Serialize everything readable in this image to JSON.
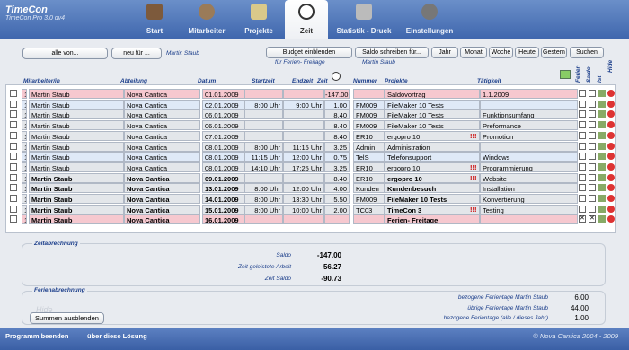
{
  "app": {
    "title": "TimeCon",
    "subtitle": "TimeCon Pro 3.0 dv4"
  },
  "nav": [
    {
      "label": "Start"
    },
    {
      "label": "Mitarbeiter"
    },
    {
      "label": "Projekte"
    },
    {
      "label": "Zeit"
    },
    {
      "label": "Statistik - Druck"
    },
    {
      "label": "Einstellungen"
    }
  ],
  "toolbar": {
    "alle_von": "alle von...",
    "neu_fur": "neu für ...",
    "filter_person": "Martin Staub",
    "budget_btn": "Budget einblenden",
    "budget_note": "für Ferien- Freitage",
    "saldo_btn": "Saldo schreiben für...",
    "saldo_person": "Martin Staub",
    "periods": [
      "Jahr",
      "Monat",
      "Woche",
      "Heute",
      "Gestern"
    ],
    "suchen": "Suchen"
  },
  "columns": {
    "mitarbeiter": "Mitarbeiter/in",
    "abteilung": "Abteilung",
    "datum": "Datum",
    "startzeit": "Startzeit",
    "endzeit": "Endzeit",
    "zeit": "Zeit",
    "nummer": "Nummer",
    "projekte": "Projekte",
    "taetigkeit": "Tätigkeit",
    "ferien": "Ferien",
    "saldo": "Saldo",
    "ist": "Ist",
    "hide": "Hide"
  },
  "rows": [
    {
      "n": "1",
      "ma": "Martin Staub",
      "abt": "Nova Cantica",
      "dat": "01.01.2009",
      "st": "",
      "en": "",
      "z": "-147.00",
      "nr": "",
      "proj": "Saldovortrag",
      "bang": "",
      "tat": "1.1.2009",
      "ferien": false,
      "saldo": true,
      "style": "pink",
      "bold": false
    },
    {
      "n": "1",
      "ma": "Martin Staub",
      "abt": "Nova Cantica",
      "dat": "02.01.2009",
      "st": "8:00 Uhr",
      "en": "9:00 Uhr",
      "z": "1.00",
      "nr": "FM009",
      "proj": "FileMaker 10 Tests",
      "bang": "",
      "tat": "",
      "ferien": false,
      "saldo": false,
      "style": "blue",
      "bold": false
    },
    {
      "n": "1",
      "ma": "Martin Staub",
      "abt": "Nova Cantica",
      "dat": "06.01.2009",
      "st": "",
      "en": "",
      "z": "8.40",
      "nr": "FM009",
      "proj": "FileMaker 10 Tests",
      "bang": "",
      "tat": "Funktionsumfang",
      "ferien": false,
      "saldo": false,
      "style": "grey",
      "bold": false
    },
    {
      "n": "1",
      "ma": "Martin Staub",
      "abt": "Nova Cantica",
      "dat": "06.01.2009",
      "st": "",
      "en": "",
      "z": "8.40",
      "nr": "FM009",
      "proj": "FileMaker 10 Tests",
      "bang": "",
      "tat": "Preformance",
      "ferien": false,
      "saldo": false,
      "style": "grey",
      "bold": false
    },
    {
      "n": "1",
      "ma": "Martin Staub",
      "abt": "Nova Cantica",
      "dat": "07.01.2009",
      "st": "",
      "en": "",
      "z": "8.40",
      "nr": "ER10",
      "proj": "ergopro 10",
      "bang": "!!!",
      "tat": "Promotion",
      "ferien": false,
      "saldo": false,
      "style": "grey",
      "bold": false
    },
    {
      "n": "1",
      "ma": "Martin Staub",
      "abt": "Nova Cantica",
      "dat": "08.01.2009",
      "st": "8:00 Uhr",
      "en": "11:15 Uhr",
      "z": "3.25",
      "nr": "Admin",
      "proj": "Administration",
      "bang": "",
      "tat": "",
      "ferien": false,
      "saldo": false,
      "style": "grey",
      "bold": false
    },
    {
      "n": "1",
      "ma": "Martin Staub",
      "abt": "Nova Cantica",
      "dat": "08.01.2009",
      "st": "11:15 Uhr",
      "en": "12:00 Uhr",
      "z": "0.75",
      "nr": "TelS",
      "proj": "Telefonsupport",
      "bang": "",
      "tat": "Windows",
      "ferien": false,
      "saldo": false,
      "style": "blue",
      "bold": false
    },
    {
      "n": "1",
      "ma": "Martin Staub",
      "abt": "Nova Cantica",
      "dat": "08.01.2009",
      "st": "14:10 Uhr",
      "en": "17:25 Uhr",
      "z": "3.25",
      "nr": "ER10",
      "proj": "ergopro 10",
      "bang": "!!!",
      "tat": "Programmierung",
      "ferien": false,
      "saldo": false,
      "style": "grey",
      "bold": false
    },
    {
      "n": "1",
      "ma": "Martin Staub",
      "abt": "Nova Cantica",
      "dat": "09.01.2009",
      "st": "",
      "en": "",
      "z": "8.40",
      "nr": "ER10",
      "proj": "ergopro 10",
      "bang": "!!!",
      "tat": "Website",
      "ferien": false,
      "saldo": false,
      "style": "grey",
      "bold": true
    },
    {
      "n": "1",
      "ma": "Martin Staub",
      "abt": "Nova Cantica",
      "dat": "13.01.2009",
      "st": "8:00 Uhr",
      "en": "12:00 Uhr",
      "z": "4.00",
      "nr": "Kunden",
      "proj": "Kundenbesuch",
      "bang": "",
      "tat": "Installation",
      "ferien": false,
      "saldo": false,
      "style": "grey",
      "bold": true
    },
    {
      "n": "1",
      "ma": "Martin Staub",
      "abt": "Nova Cantica",
      "dat": "14.01.2009",
      "st": "8:00 Uhr",
      "en": "13:30 Uhr",
      "z": "5.50",
      "nr": "FM009",
      "proj": "FileMaker 10 Tests",
      "bang": "",
      "tat": "Konvertierung",
      "ferien": false,
      "saldo": false,
      "style": "grey",
      "bold": true
    },
    {
      "n": "1",
      "ma": "Martin Staub",
      "abt": "Nova Cantica",
      "dat": "15.01.2009",
      "st": "8:00 Uhr",
      "en": "10:00 Uhr",
      "z": "2.00",
      "nr": "TC03",
      "proj": "TimeCon 3",
      "bang": "!!!",
      "tat": "Testing",
      "ferien": false,
      "saldo": false,
      "style": "grey",
      "bold": true
    },
    {
      "n": "1",
      "ma": "Martin Staub",
      "abt": "Nova Cantica",
      "dat": "16.01.2009",
      "st": "",
      "en": "",
      "z": "",
      "nr": "",
      "proj": "Ferien- Freitage",
      "bang": "",
      "tat": "",
      "ferien": true,
      "saldo": true,
      "style": "pink",
      "bold": true
    }
  ],
  "zeitabrechnung": {
    "title": "Zeitabrechnung",
    "saldo_label": "Saldo",
    "saldo": "-147.00",
    "geleistet_label": "Zeit geleistete Arbeit",
    "geleistet": "56.27",
    "zeitsaldo_label": "Zeit Saldo",
    "zeitsaldo": "-90.73"
  },
  "ferien": {
    "title": "Ferienabrechnung",
    "hint": "Hide",
    "bez_label": "bezogene Ferientage Martin Staub",
    "bez": "6.00",
    "ueb_label": "übrige Ferientage Martin Staub",
    "ueb": "44.00",
    "ges_label": "bezogene Ferientage (alle / dieses Jahr)",
    "ges": "1.00",
    "summen_btn": "Summen ausblenden"
  },
  "footer": {
    "beenden": "Programm beenden",
    "ueber": "über diese Lösung",
    "copyright": "© Nova Cantica 2004 - 2009"
  }
}
